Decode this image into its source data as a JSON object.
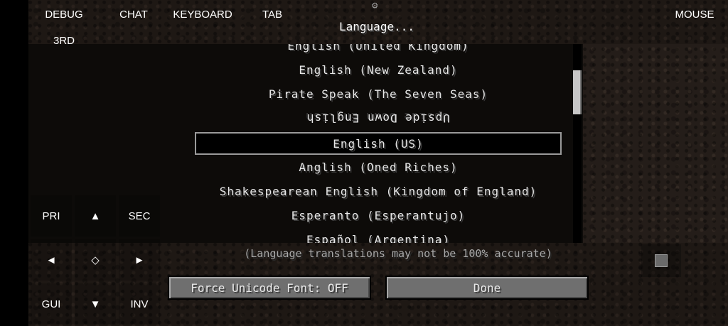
{
  "title": "Language...",
  "languages": [
    {
      "label": "English (United Kingdom)"
    },
    {
      "label": "English (New Zealand)"
    },
    {
      "label": "Pirate Speak (The Seven Seas)"
    },
    {
      "label": "Upside Down English"
    },
    {
      "label": "English (US)"
    },
    {
      "label": "Anglish (Oned Riches)"
    },
    {
      "label": "Shakespearean English (Kingdom of England)"
    },
    {
      "label": "Esperanto (Esperantujo)"
    },
    {
      "label": "Español (Argentina)"
    }
  ],
  "note": "(Language translations may not be 100% accurate)",
  "buttons": {
    "unicode": "Force Unicode Font: OFF",
    "done": "Done"
  },
  "controls": {
    "debug": "DEBUG",
    "chat": "CHAT",
    "keyboard": "KEYBOARD",
    "tab": "TAB",
    "mouse": "MOUSE",
    "third": "3RD",
    "pri": "PRI",
    "sec": "SEC",
    "gui": "GUI",
    "inv": "INV",
    "up": "▲",
    "down": "▼",
    "left": "◄",
    "right": "►",
    "center": "◇"
  },
  "icons": {
    "settings": "gear-icon"
  }
}
